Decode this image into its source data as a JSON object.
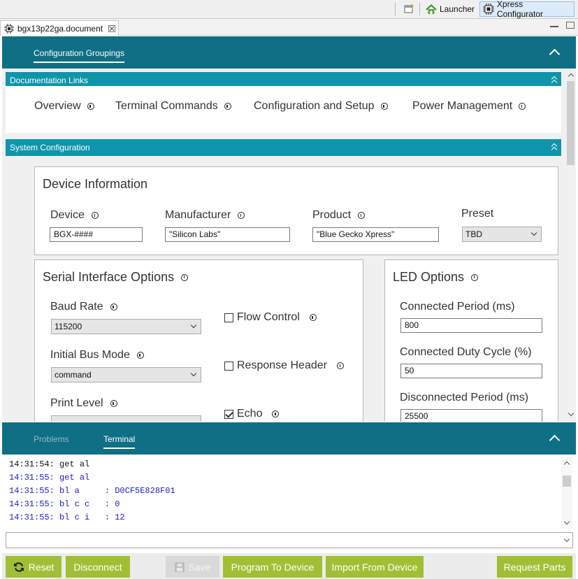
{
  "toolbar": {
    "launcher_label": "Launcher",
    "xpress_label": "Xpress Configurator"
  },
  "editor": {
    "tab_title": "bgx13p22ga.document"
  },
  "header": {
    "tab_label": "Configuration Groupings"
  },
  "doc_links": {
    "title": "Documentation Links",
    "links": [
      "Overview",
      "Terminal Commands",
      "Configuration and Setup",
      "Power Management"
    ]
  },
  "system_config": {
    "title": "System Configuration"
  },
  "device_info": {
    "title": "Device Information",
    "device_label": "Device",
    "device_value": "BGX-####",
    "manufacturer_label": "Manufacturer",
    "manufacturer_value": "\"Silicon Labs\"",
    "product_label": "Product",
    "product_value": "\"Blue Gecko Xpress\"",
    "preset_label": "Preset",
    "preset_value": "TBD"
  },
  "serial": {
    "title": "Serial Interface Options",
    "baud_label": "Baud Rate",
    "baud_value": "115200",
    "bus_label": "Initial Bus Mode",
    "bus_value": "command",
    "print_label": "Print Level",
    "flow_label": "Flow Control",
    "flow_checked": false,
    "response_label": "Response Header",
    "response_checked": false,
    "echo_label": "Echo",
    "echo_checked": true
  },
  "led": {
    "title": "LED Options",
    "connected_period_label": "Connected Period (ms)",
    "connected_period_value": "800",
    "duty_label": "Connected Duty Cycle (%)",
    "duty_value": "50",
    "disconnected_label": "Disconnected Period (ms)",
    "disconnected_value": "25500"
  },
  "bottom_tabs": {
    "problems": "Problems",
    "terminal": "Terminal"
  },
  "terminal": {
    "lines": [
      {
        "time": "14:31:54:",
        "text": "get al",
        "color": "#111111"
      },
      {
        "time": "14:31:55:",
        "text": "get al",
        "color": "#1c1cd0"
      },
      {
        "time": "14:31:55:",
        "text": "bl a     : D0CF5E828F01",
        "color": "#1c1cd0"
      },
      {
        "time": "14:31:55:",
        "text": "bl c c   : 0",
        "color": "#1c1cd0"
      },
      {
        "time": "14:31:55:",
        "text": "bl c i   : 12",
        "color": "#1c1cd0"
      }
    ]
  },
  "buttons": {
    "reset": "Reset",
    "disconnect": "Disconnect",
    "save": "Save",
    "program": "Program To Device",
    "import": "Import From Device",
    "request": "Request Parts"
  },
  "colors": {
    "header_band": "#0f6f85",
    "section_bar": "#0f95ab",
    "button_green": "#a1bf34"
  }
}
